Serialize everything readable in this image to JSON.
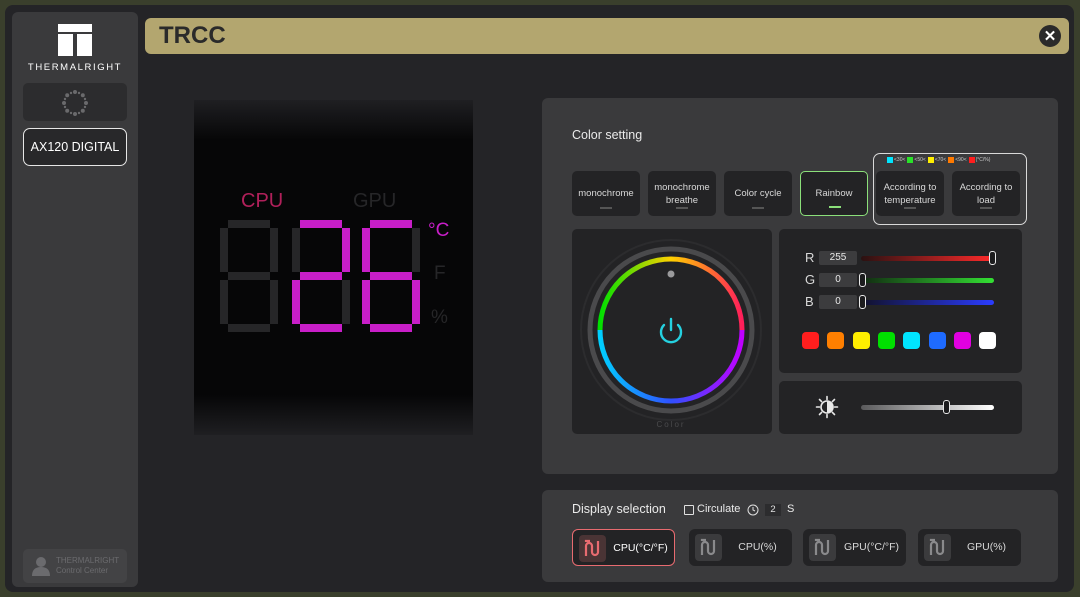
{
  "app": {
    "title": "TRCC",
    "brand": "THERMALRIGHT"
  },
  "sidebar": {
    "device": "AX120 DIGITAL",
    "control_center": [
      "THERMALRIGHT",
      "Control Center"
    ]
  },
  "preview": {
    "labels": {
      "cpu": "CPU",
      "gpu": "GPU"
    },
    "reading": "26",
    "units": {
      "celsius": "°C",
      "fahrenheit": "F",
      "percent": "%"
    },
    "active_color": "#c81ec8",
    "cpu_label_color": "#b0205a",
    "dim_color": "#262628"
  },
  "color_setting": {
    "label": "Color setting",
    "modes": [
      "monochrome",
      "monochrome\nbreathe",
      "Color cycle",
      "Rainbow",
      "According to\ntemperature",
      "According to\nload"
    ],
    "active_mode": "Rainbow",
    "legend": [
      {
        "color": "#00e5ff",
        "text": "<30<"
      },
      {
        "color": "#29e329",
        "text": "<50<"
      },
      {
        "color": "#ffee00",
        "text": "<70<"
      },
      {
        "color": "#ff7a00",
        "text": "<90<"
      },
      {
        "color": "#ff1e1e",
        "text": "(°C/%)"
      }
    ],
    "wheel_caption": "Color",
    "rgb": {
      "r": "255",
      "g": "0",
      "b": "0"
    },
    "rgb_labels": {
      "r": "R",
      "g": "G",
      "b": "B"
    },
    "swatches": [
      "#ff1e1e",
      "#ff7f00",
      "#ffee00",
      "#00e000",
      "#00e5ff",
      "#1e6bff",
      "#e100e1",
      "#ffffff"
    ],
    "brightness": 0.65,
    "accent": "#25d1e0"
  },
  "display_selection": {
    "label": "Display selection",
    "circulate_label": "Circulate",
    "interval": "2",
    "interval_unit": "S",
    "options": [
      "CPU(°C/°F)",
      "CPU(%)",
      "GPU(°C/°F)",
      "GPU(%)"
    ],
    "active": "CPU(°C/°F)"
  }
}
